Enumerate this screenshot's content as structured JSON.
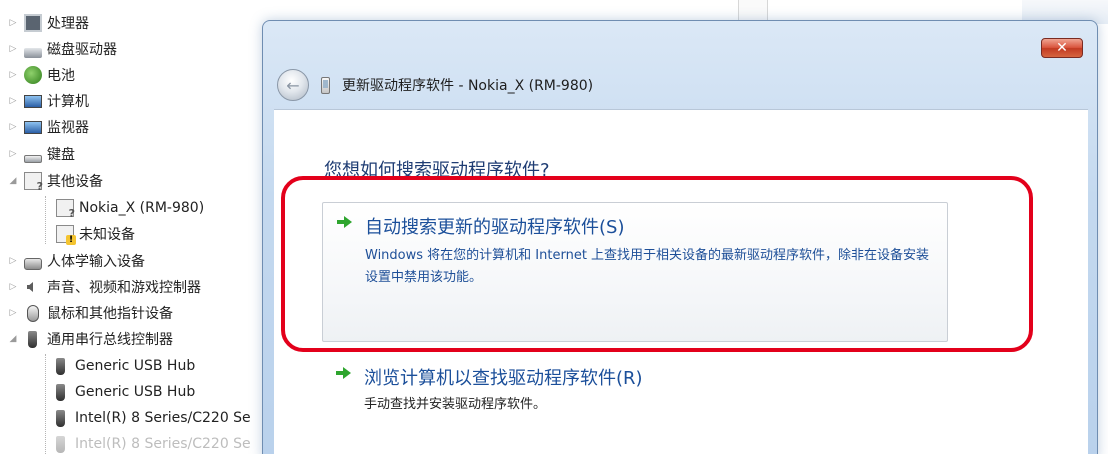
{
  "tree": {
    "items": [
      {
        "label": "处理器",
        "icon": "processor-icon",
        "expander": "▷"
      },
      {
        "label": "磁盘驱动器",
        "icon": "disk-drive-icon",
        "expander": "▷"
      },
      {
        "label": "电池",
        "icon": "battery-icon",
        "expander": "▷"
      },
      {
        "label": "计算机",
        "icon": "computer-icon",
        "expander": "▷"
      },
      {
        "label": "监视器",
        "icon": "monitor-icon",
        "expander": "▷"
      },
      {
        "label": "键盘",
        "icon": "keyboard-icon",
        "expander": "▷"
      },
      {
        "label": "其他设备",
        "icon": "other-devices-icon",
        "expander": "◢"
      },
      {
        "label": "Nokia_X (RM-980)",
        "icon": "unknown-device-icon",
        "expander": ""
      },
      {
        "label": "未知设备",
        "icon": "unknown-device-warning-icon",
        "expander": ""
      },
      {
        "label": "人体学输入设备",
        "icon": "hid-icon",
        "expander": "▷"
      },
      {
        "label": "声音、视频和游戏控制器",
        "icon": "speaker-icon",
        "expander": "▷"
      },
      {
        "label": "鼠标和其他指针设备",
        "icon": "mouse-icon",
        "expander": "▷"
      },
      {
        "label": "通用串行总线控制器",
        "icon": "usb-icon",
        "expander": "◢"
      },
      {
        "label": "Generic USB Hub",
        "icon": "usb-icon",
        "expander": ""
      },
      {
        "label": "Generic USB Hub",
        "icon": "usb-icon",
        "expander": ""
      },
      {
        "label": "Intel(R) 8 Series/C220 Se",
        "icon": "usb-icon",
        "expander": ""
      },
      {
        "label": "Intel(R) 8 Series/C220 Se",
        "icon": "usb-icon",
        "expander": ""
      }
    ]
  },
  "dialog": {
    "close_label": "✕",
    "back_icon": "back-arrow-icon",
    "title": "更新驱动程序软件 - Nokia_X (RM-980)",
    "question": "您想如何搜索驱动程序软件?",
    "options": [
      {
        "title": "自动搜索更新的驱动程序软件(S)",
        "description": "Windows 将在您的计算机和 Internet 上查找用于相关设备的最新驱动程序软件，除非在设备安装设置中禁用该功能。"
      },
      {
        "title": "浏览计算机以查找驱动程序软件(R)",
        "description": "手动查找并安装驱动程序软件。"
      }
    ]
  },
  "colors": {
    "highlight": "#e3001b",
    "link_blue": "#1b4f9a",
    "arrow_green": "#2ea52e"
  }
}
